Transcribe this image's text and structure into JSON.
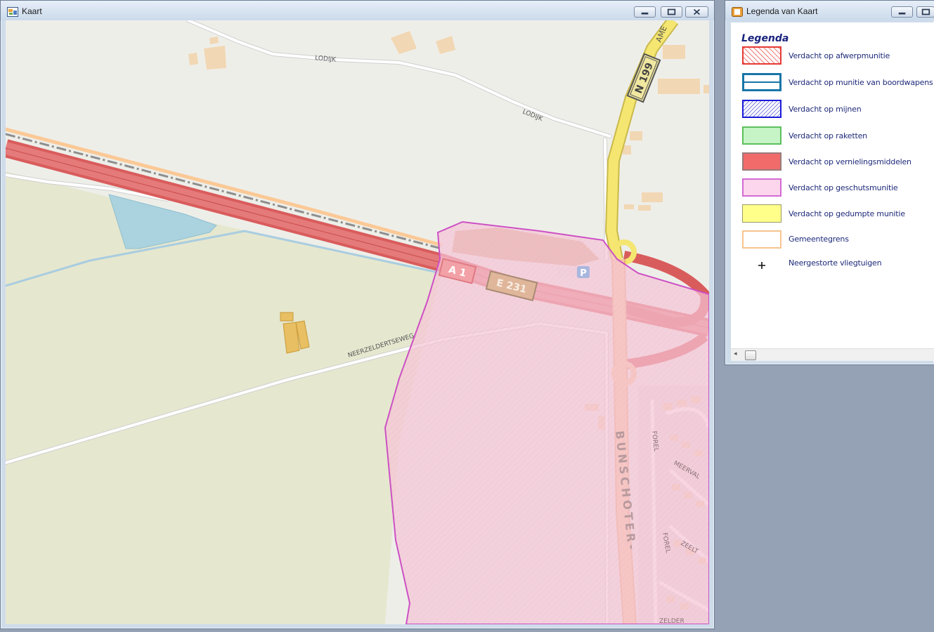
{
  "map_window": {
    "title": "Kaart",
    "icon": "map-app-icon",
    "controls": [
      "minimize-icon",
      "maximize-icon",
      "close-icon"
    ]
  },
  "map": {
    "road_labels": {
      "lodijk_1": "LODIJK",
      "lodijk_2": "LODIJK",
      "neerzeldertseweg": "NEERZELDERTSEWEG",
      "ame": "AME",
      "bunschoter": "BUNSCHOTER-",
      "forel_1": "FOREL",
      "forel_2": "FOREL",
      "meerval": "MEERVAL",
      "zeelt": "ZEELT",
      "zelder": "ZELDER"
    },
    "shields": {
      "n199": "N 199",
      "a1": "A 1",
      "e231": "E 231",
      "parking": "P"
    },
    "colors": {
      "land": "#eeeee9",
      "field": "#e8e8cf",
      "motorway": "#e06666",
      "primary": "#f4e670",
      "secondary": "#f7c89a",
      "water": "#aad3df",
      "zone_fill": "#f5c4d6",
      "zone_border": "#cc4fc4",
      "boundary": "#fbc996",
      "building": "#f1d7b3"
    }
  },
  "legend_window": {
    "title": "Legenda van Kaart",
    "icon": "legend-app-icon",
    "heading": "Legenda",
    "items": [
      {
        "label": "Verdacht op afwerpmunitie",
        "swatch": "red-hatched"
      },
      {
        "label": "Verdacht op munitie van boordwapens",
        "swatch": "blue-double-line"
      },
      {
        "label": "Verdacht op mijnen",
        "swatch": "blue-hatched"
      },
      {
        "label": "Verdacht op raketten",
        "swatch": "green"
      },
      {
        "label": "Verdacht op vernielingsmiddelen",
        "swatch": "red"
      },
      {
        "label": "Verdacht op geschutsmunitie",
        "swatch": "pink"
      },
      {
        "label": "Verdacht op gedumpte munitie",
        "swatch": "yellow"
      },
      {
        "label": "Gemeentegrens",
        "swatch": "orange-outline"
      },
      {
        "label": "Neergestorte vliegtuigen",
        "swatch": "plus-icon"
      }
    ]
  }
}
